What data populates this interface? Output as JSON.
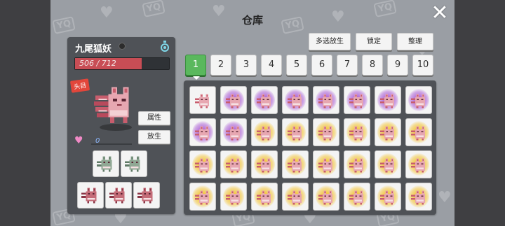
{
  "title": "仓库",
  "close_icon": "close-icon",
  "buttons": {
    "multi_release": "多选放生",
    "lock": "锁定",
    "sort": "整理"
  },
  "pet": {
    "name": "九尾狐妖",
    "hp_text": "506 / 712",
    "hp_current": 506,
    "hp_max": 712,
    "leader_tag": "头目",
    "attr_button": "属性",
    "release_button": "放生",
    "love_value": "0"
  },
  "tabs": [
    "1",
    "2",
    "3",
    "4",
    "5",
    "6",
    "7",
    "8",
    "9",
    "10"
  ],
  "active_tab": "1",
  "colors": {
    "hp": "#c84d55",
    "tab_active": "#5ab85d",
    "panel": "#4f5257",
    "aura_purple": "#b26bd8",
    "aura_gold": "#f3c845"
  },
  "team_slots": [
    "green-fox-icon",
    "green-fox-icon",
    "red-fox-icon",
    "red-fox-icon",
    "red-fox-icon"
  ],
  "storage": [
    [
      "none",
      "purple",
      "purple",
      "purple",
      "purple",
      "purple",
      "purple",
      "purple"
    ],
    [
      "purple",
      "purple",
      "gold",
      "gold",
      "gold",
      "gold",
      "gold",
      "gold"
    ],
    [
      "gold",
      "gold",
      "gold",
      "gold",
      "gold",
      "gold",
      "gold",
      "gold"
    ],
    [
      "gold",
      "gold",
      "gold",
      "gold",
      "gold",
      "gold",
      "gold",
      "gold"
    ]
  ]
}
